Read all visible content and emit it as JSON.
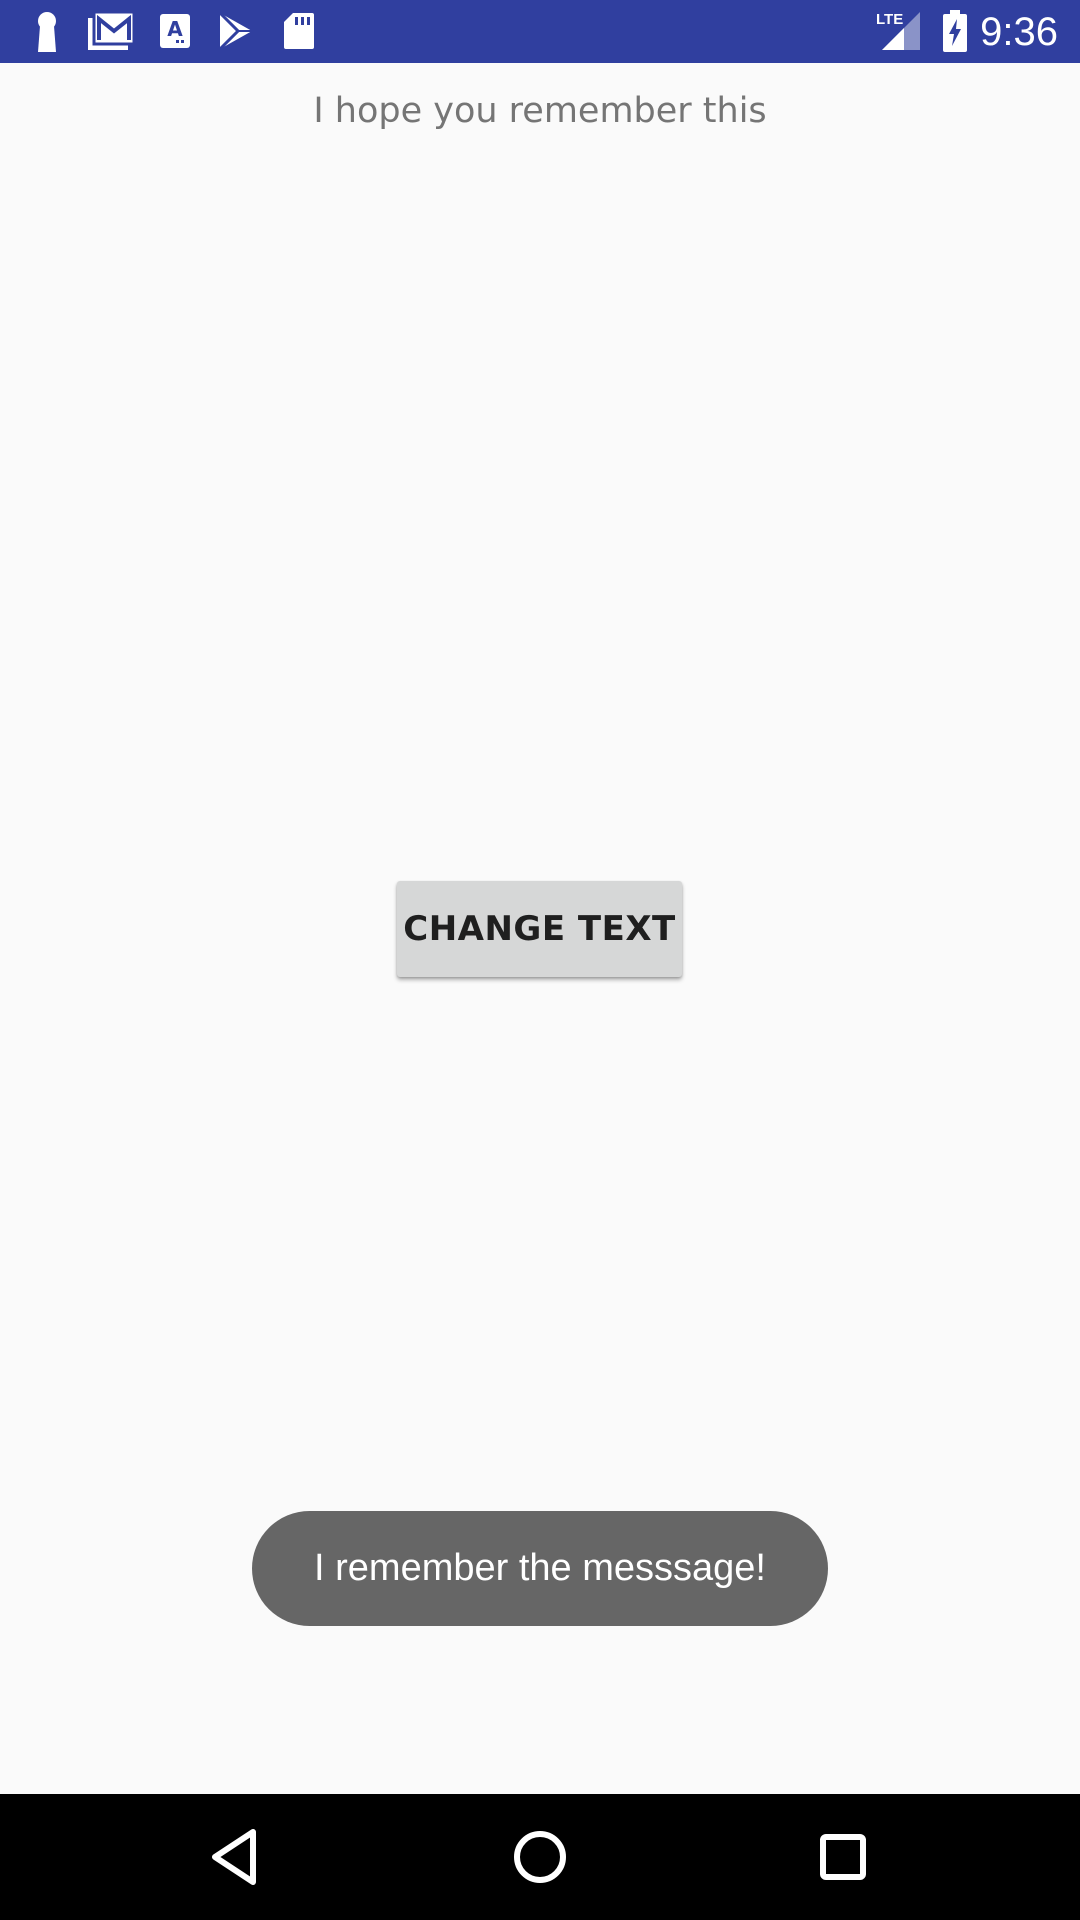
{
  "status_bar": {
    "time": "9:36",
    "network": "LTE",
    "left_icons": [
      "keyhole-icon",
      "gmail-icon",
      "a-font-icon",
      "play-store-icon",
      "sd-card-icon"
    ],
    "right_icons": [
      "lte-signal-icon",
      "battery-charging-icon"
    ],
    "color": "#303f9f"
  },
  "main": {
    "message": "I hope you remember this",
    "button_label": "CHANGE TEXT"
  },
  "toast": {
    "text": "I remember the messsage!"
  },
  "nav_bar": {
    "buttons": [
      "back-icon",
      "home-icon",
      "recents-icon"
    ]
  }
}
